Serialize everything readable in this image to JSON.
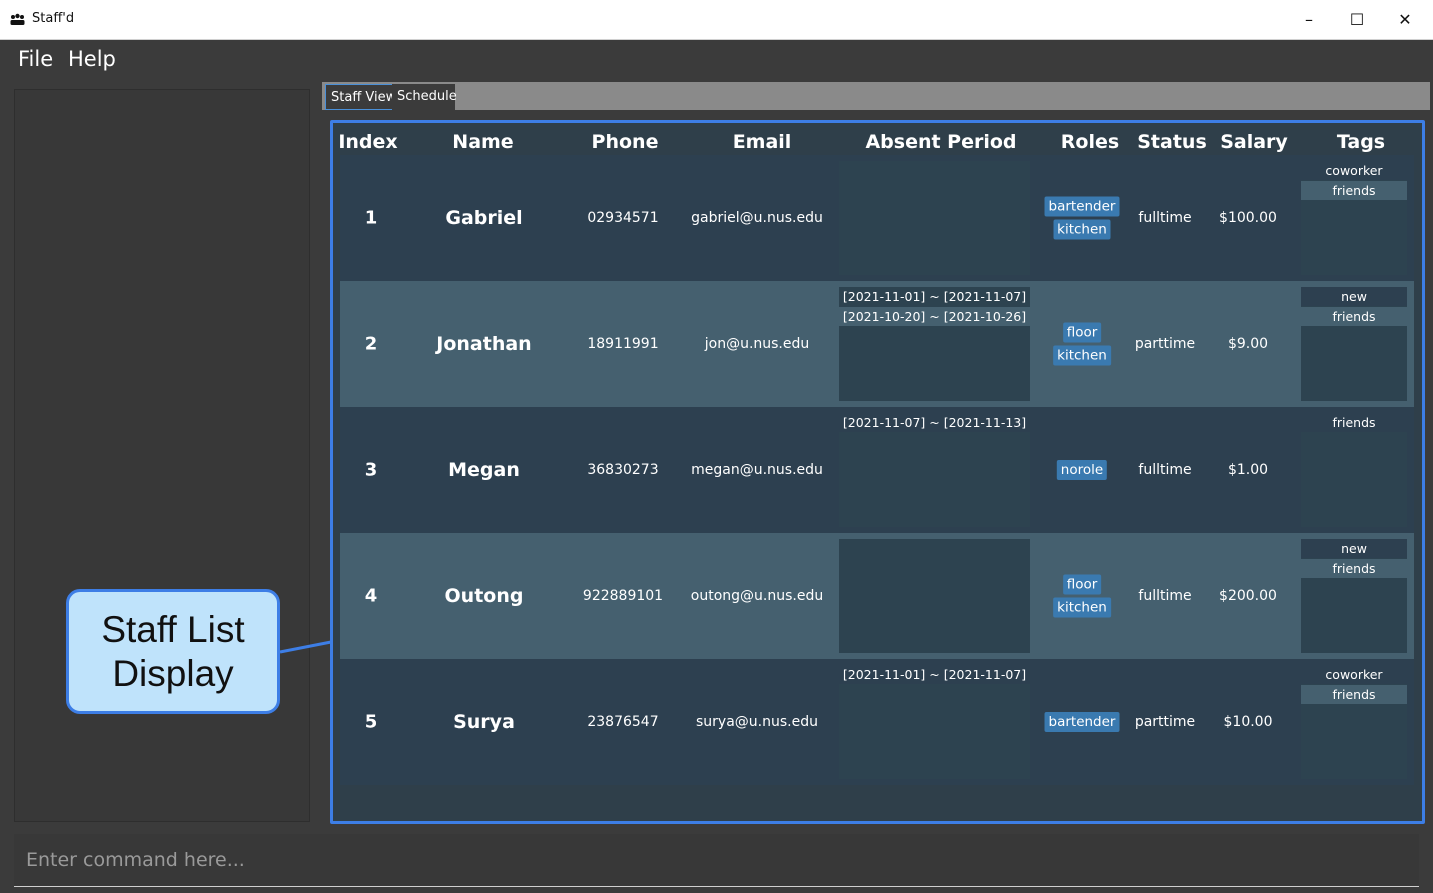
{
  "window": {
    "title": "Staff'd",
    "minimize_glyph": "–",
    "maximize_glyph": "☐",
    "close_glyph": "✕"
  },
  "menu": {
    "items": [
      {
        "label": "File"
      },
      {
        "label": "Help"
      }
    ]
  },
  "tabs": [
    {
      "label": "Staff View",
      "active": true
    },
    {
      "label": "Schedule",
      "active": false
    }
  ],
  "staff_table": {
    "headers": {
      "index": "Index",
      "name": "Name",
      "phone": "Phone",
      "email": "Email",
      "absent_period": "Absent Period",
      "roles": "Roles",
      "status": "Status",
      "salary": "Salary",
      "tags": "Tags"
    },
    "rows": [
      {
        "index": "1",
        "name": "Gabriel",
        "phone": "02934571",
        "email": "gabriel@u.nus.edu",
        "absent": [],
        "roles": [
          "bartender",
          "kitchen"
        ],
        "status": "fulltime",
        "salary": "$100.00",
        "tags": [
          "coworker",
          "friends"
        ]
      },
      {
        "index": "2",
        "name": "Jonathan",
        "phone": "18911991",
        "email": "jon@u.nus.edu",
        "absent": [
          "[2021-11-01] ~ [2021-11-07]",
          "[2021-10-20] ~ [2021-10-26]"
        ],
        "roles": [
          "floor",
          "kitchen"
        ],
        "status": "parttime",
        "salary": "$9.00",
        "tags": [
          "new",
          "friends"
        ]
      },
      {
        "index": "3",
        "name": "Megan",
        "phone": "36830273",
        "email": "megan@u.nus.edu",
        "absent": [
          "[2021-11-07] ~ [2021-11-13]"
        ],
        "roles": [
          "norole"
        ],
        "status": "fulltime",
        "salary": "$1.00",
        "tags": [
          "friends"
        ]
      },
      {
        "index": "4",
        "name": "Outong",
        "phone": "922889101",
        "email": "outong@u.nus.edu",
        "absent": [],
        "roles": [
          "floor",
          "kitchen"
        ],
        "status": "fulltime",
        "salary": "$200.00",
        "tags": [
          "new",
          "friends"
        ]
      },
      {
        "index": "5",
        "name": "Surya",
        "phone": "23876547",
        "email": "surya@u.nus.edu",
        "absent": [
          "[2021-11-01] ~ [2021-11-07]"
        ],
        "roles": [
          "bartender"
        ],
        "status": "parttime",
        "salary": "$10.00",
        "tags": [
          "coworker",
          "friends"
        ]
      }
    ]
  },
  "command_box": {
    "placeholder": "Enter command here..."
  },
  "callout": {
    "line1": "Staff List",
    "line2": "Display"
  },
  "colors": {
    "accent": "#3d7ee6",
    "row_dark": "#2d4050",
    "row_light": "#45606f",
    "role_pill": "#3a7ab0",
    "callout_bg": "#bfe3fb"
  }
}
